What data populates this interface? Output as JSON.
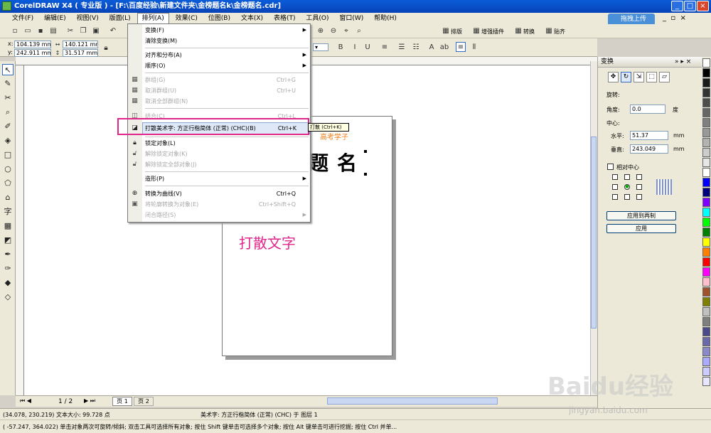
{
  "window": {
    "title": "CorelDRAW X4 ( 专业版 ) - [F:\\百度经验\\新建文件夹\\金榜题名k\\金榜题名.cdr]",
    "minimize": "_",
    "maximize": "□",
    "close": "×"
  },
  "menubar": [
    "文件(F)",
    "编辑(E)",
    "视图(V)",
    "版面(L)",
    "排列(A)",
    "效果(C)",
    "位图(B)",
    "文本(X)",
    "表格(T)",
    "工具(O)",
    "窗口(W)",
    "帮助(H)"
  ],
  "upload_button": "拖拽上传",
  "toolbar_right": {
    "paiban": "排版",
    "enhance": "增强插件",
    "convert": "转换",
    "align": "贴齐"
  },
  "properties": {
    "x": "104.139 mm",
    "y": "242.911 mm",
    "width": "140.121 mm",
    "height": "31.517 mm",
    "x_label": "x:",
    "y_label": "y:"
  },
  "arrange_menu": {
    "items": [
      {
        "label": "变换(F)",
        "shortcut": "",
        "submenu": true,
        "disabled": false
      },
      {
        "label": "清除变换(M)",
        "shortcut": "",
        "submenu": false,
        "disabled": false
      },
      {
        "label": "对齐和分布(A)",
        "shortcut": "",
        "submenu": true,
        "disabled": false
      },
      {
        "label": "顺序(O)",
        "shortcut": "",
        "submenu": true,
        "disabled": false
      },
      {
        "label": "群组(G)",
        "shortcut": "Ctrl+G",
        "submenu": false,
        "disabled": true
      },
      {
        "label": "取消群组(U)",
        "shortcut": "Ctrl+U",
        "submenu": false,
        "disabled": true
      },
      {
        "label": "取消全部群组(N)",
        "shortcut": "",
        "submenu": false,
        "disabled": true
      },
      {
        "label": "结合(C)",
        "shortcut": "Ctrl+L",
        "submenu": false,
        "disabled": true
      },
      {
        "label": "打散美术字: 方正行楷简体 (正常) (CHC)(B)",
        "shortcut": "Ctrl+K",
        "submenu": false,
        "disabled": false
      },
      {
        "label": "锁定对象(L)",
        "shortcut": "",
        "submenu": false,
        "disabled": false
      },
      {
        "label": "解除锁定对象(K)",
        "shortcut": "",
        "submenu": false,
        "disabled": true
      },
      {
        "label": "解除锁定全部对象(J)",
        "shortcut": "",
        "submenu": false,
        "disabled": true
      },
      {
        "label": "造形(P)",
        "shortcut": "",
        "submenu": true,
        "disabled": false
      },
      {
        "label": "转换为曲线(V)",
        "shortcut": "Ctrl+Q",
        "submenu": false,
        "disabled": false
      },
      {
        "label": "将轮廓转换为对象(E)",
        "shortcut": "Ctrl+Shift+Q",
        "submenu": false,
        "disabled": true
      },
      {
        "label": "闭合路径(S)",
        "shortcut": "",
        "submenu": true,
        "disabled": true
      }
    ]
  },
  "tooltip": "打散 (Ctrl+K)",
  "canvas": {
    "heading_text": "题名",
    "orange_text": "高考学子",
    "annotation": "打散文字"
  },
  "docker": {
    "title": "变换",
    "rotate_label": "旋转:",
    "angle_label": "角度:",
    "angle_value": "0.0",
    "angle_unit": "度",
    "center_label": "中心:",
    "h_label": "水平:",
    "h_value": "51.37",
    "h_unit": "mm",
    "v_label": "垂直:",
    "v_value": "243.049",
    "v_unit": "mm",
    "relative_center": "相对中心",
    "apply_copy": "应用到再制",
    "apply": "应用"
  },
  "pages": {
    "counter": "1 / 2",
    "tab1": "页 1",
    "tab2": "页 2"
  },
  "status": {
    "line1_left": "(34.078, 230.219)  文本大小: 99.728 点",
    "line1_mid": "美术字: 方正行楷简体 (正常) (CHC) 于 图层 1",
    "line2": "( -57.247, 364.022)   单击对象两次可旋转/倾斜; 双击工具可选择所有对象; 按住 Shift 键单击可选择多个对象; 按住 Alt 键单击可进行挖掘; 按住 Ctrl 并单..."
  },
  "watermark": {
    "brand": "Baidu经验",
    "url": "jingyan.baidu.com"
  },
  "palette_colors": [
    "#ffffff",
    "#000000",
    "#1a1a1a",
    "#333333",
    "#4d4d4d",
    "#666666",
    "#808080",
    "#999999",
    "#b3b3b3",
    "#cccccc",
    "#e6e6e6",
    "#ffffff",
    "#0000ff",
    "#00007f",
    "#7f00ff",
    "#00ffff",
    "#00ff00",
    "#008000",
    "#ffff00",
    "#ff8000",
    "#ff0000",
    "#ff00ff",
    "#ffc0cb",
    "#a0522d",
    "#808000",
    "#c0c0c0",
    "#7f7f7f",
    "#4a4a8a",
    "#6a6aaa",
    "#8a8aca",
    "#aaaaff",
    "#ccccff",
    "#e6e6ff"
  ]
}
